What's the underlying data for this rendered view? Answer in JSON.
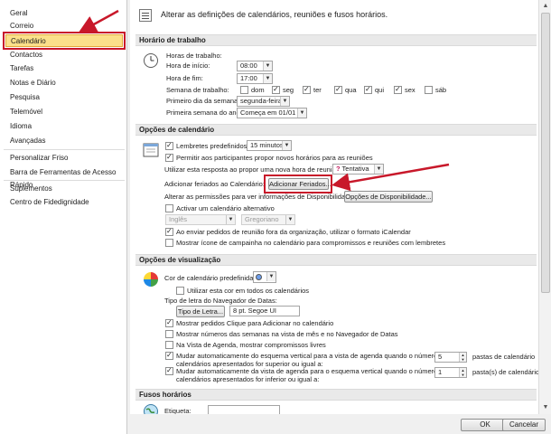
{
  "sidebar": {
    "items": [
      "Geral",
      "Correio",
      "Calendário",
      "Contactos",
      "Tarefas",
      "Notas e Diário",
      "Pesquisa",
      "Telemóvel",
      "Idioma",
      "Avançadas",
      "Personalizar Friso",
      "Barra de Ferramentas de Acesso Rápido",
      "Suplementos",
      "Centro de Fidedignidade"
    ],
    "selected_index": 2
  },
  "header": {
    "title": "Alterar as definições de calendários, reuniões e fusos horários."
  },
  "work_hours": {
    "section": "Horário de trabalho",
    "hours_label": "Horas de trabalho:",
    "start_label": "Hora de início:",
    "start_value": "08:00",
    "end_label": "Hora de fim:",
    "end_value": "17:00",
    "week_label": "Semana de trabalho:",
    "days": [
      {
        "label": "dom",
        "checked": false
      },
      {
        "label": "seg",
        "checked": true
      },
      {
        "label": "ter",
        "checked": true
      },
      {
        "label": "qua",
        "checked": true
      },
      {
        "label": "qui",
        "checked": true
      },
      {
        "label": "sex",
        "checked": true
      },
      {
        "label": "sáb",
        "checked": false
      }
    ],
    "first_day_label": "Primeiro dia da semana:",
    "first_day_value": "segunda-feira",
    "first_week_label": "Primeira semana do ano:",
    "first_week_value": "Começa em 01/01"
  },
  "calendar_options": {
    "section": "Opções de calendário",
    "reminders_label": "Lembretes predefinidos:",
    "reminders_value": "15 minutos",
    "propose_label": "Permitir aos participantes propor novos horários para as reuniões",
    "response_label": "Utilizar esta resposta ao propor uma nova hora de reunião:",
    "response_value": "Tentativa",
    "response_icon": "?",
    "holidays_label": "Adicionar feriados ao Calendário:",
    "holidays_button": "Adicionar Feriados...",
    "availability_label": "Alterar as permissões para ver informações de Disponibilidade:",
    "availability_button": "Opções de Disponibilidade...",
    "alt_calendar_label": "Activar um calendário alternativo",
    "alt_language": "Inglês",
    "alt_type": "Gregoriano",
    "icalendar_label": "Ao enviar pedidos de reunião fora da organização, utilizar o formato iCalendar",
    "bell_label": "Mostrar ícone de campainha no calendário para compromissos e reuniões com lembretes"
  },
  "display_options": {
    "section": "Opções de visualização",
    "color_label": "Cor de calendário predefinida:",
    "color_value": "#6d9eeb",
    "all_calendars_label": "Utilizar esta cor em todos os calendários",
    "font_label": "Tipo de letra do Navegador de Datas:",
    "font_button": "Tipo de Letra...",
    "font_value": "8 pt. Segoe UI",
    "click_to_add_label": "Mostrar pedidos Clique para Adicionar no calendário",
    "week_numbers_label": "Mostrar números das semanas na vista de mês e no Navegador de Datas",
    "free_appts_label": "Na Vista de Agenda, mostrar compromissos livres",
    "switch_horizontal_label_1": "Mudar automaticamente do esquema vertical para a vista de agenda quando o número de",
    "switch_horizontal_label_2": "calendários apresentados for superior ou igual a:",
    "switch_horizontal_value": "5",
    "switch_horizontal_unit": "pastas de calendário",
    "switch_vertical_label_1": "Mudar automaticamente da vista de agenda para o esquema vertical quando o número de",
    "switch_vertical_label_2": "calendários apresentados for inferior ou igual a:",
    "switch_vertical_value": "1",
    "switch_vertical_unit": "pasta(s) de calendário"
  },
  "time_zones": {
    "section": "Fusos horários",
    "label_label": "Etiqueta:",
    "label_value": ""
  },
  "footer": {
    "ok": "OK",
    "cancel": "Cancelar"
  },
  "colors": {
    "highlight": "#fbe08a",
    "annotation_red": "#c8182a"
  }
}
